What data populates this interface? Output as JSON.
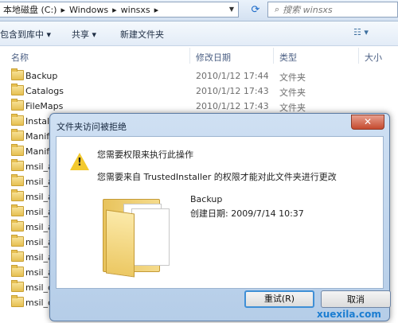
{
  "address": {
    "path": [
      "本地磁盘 (C:)",
      "▸",
      "Windows",
      "▸",
      "winsxs",
      "▸"
    ],
    "search_placeholder": "搜索 winsxs"
  },
  "toolbar": {
    "include_in_library": "包含到库中 ▾",
    "share": "共享 ▾",
    "new_folder": "新建文件夹",
    "view_options": "☷ ▾"
  },
  "columns": {
    "name": "名称",
    "modified": "修改日期",
    "type": "类型",
    "size": "大小"
  },
  "files": [
    {
      "name": "Backup",
      "date": "2010/1/12 17:44",
      "type": "文件夹"
    },
    {
      "name": "Catalogs",
      "date": "2010/1/12 17:43",
      "type": "文件夹"
    },
    {
      "name": "FileMaps",
      "date": "2010/1/12 17:43",
      "type": "文件夹"
    },
    {
      "name": "Instal",
      "date": "",
      "type": ""
    },
    {
      "name": "Manif",
      "date": "",
      "type": ""
    },
    {
      "name": "Manif",
      "date": "",
      "type": ""
    },
    {
      "name": "msil_a",
      "date": "",
      "type": ""
    },
    {
      "name": "msil_a",
      "date": "",
      "type": ""
    },
    {
      "name": "msil_a",
      "date": "",
      "type": ""
    },
    {
      "name": "msil_a",
      "date": "",
      "type": ""
    },
    {
      "name": "msil_a",
      "date": "",
      "type": ""
    },
    {
      "name": "msil_a",
      "date": "",
      "type": ""
    },
    {
      "name": "msil_a",
      "date": "",
      "type": ""
    },
    {
      "name": "msil_a",
      "date": "",
      "type": ""
    },
    {
      "name": "msil_c",
      "date": "",
      "type": ""
    },
    {
      "name": "msil_c",
      "date": "",
      "type": ""
    }
  ],
  "dialog": {
    "title": "文件夹访问被拒绝",
    "close_glyph": "✕",
    "message1": "您需要权限来执行此操作",
    "message2": "您需要来自 TrustedInstaller 的权限才能对此文件夹进行更改",
    "folder_name": "Backup",
    "created": "创建日期: 2009/7/14 10:37",
    "retry": "重试(R)",
    "cancel": "取消"
  },
  "watermark": "xuexila.com"
}
